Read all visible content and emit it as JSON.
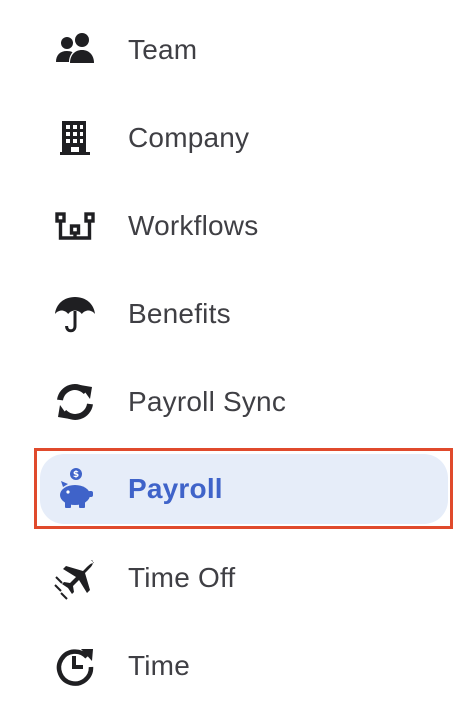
{
  "nav": {
    "items": [
      {
        "label": "Team",
        "icon": "team-icon"
      },
      {
        "label": "Company",
        "icon": "building-icon"
      },
      {
        "label": "Workflows",
        "icon": "workflow-icon"
      },
      {
        "label": "Benefits",
        "icon": "umbrella-icon"
      },
      {
        "label": "Payroll Sync",
        "icon": "sync-icon"
      },
      {
        "label": "Payroll",
        "icon": "piggy-bank-icon",
        "active": true
      },
      {
        "label": "Time Off",
        "icon": "airplane-icon"
      },
      {
        "label": "Time",
        "icon": "clock-refresh-icon"
      }
    ]
  },
  "colors": {
    "active_text": "#3f63c9",
    "active_background": "#e6edf9",
    "highlight_border": "#e04a2c",
    "label_text": "#3f3f44",
    "icon": "#1f1f22"
  }
}
